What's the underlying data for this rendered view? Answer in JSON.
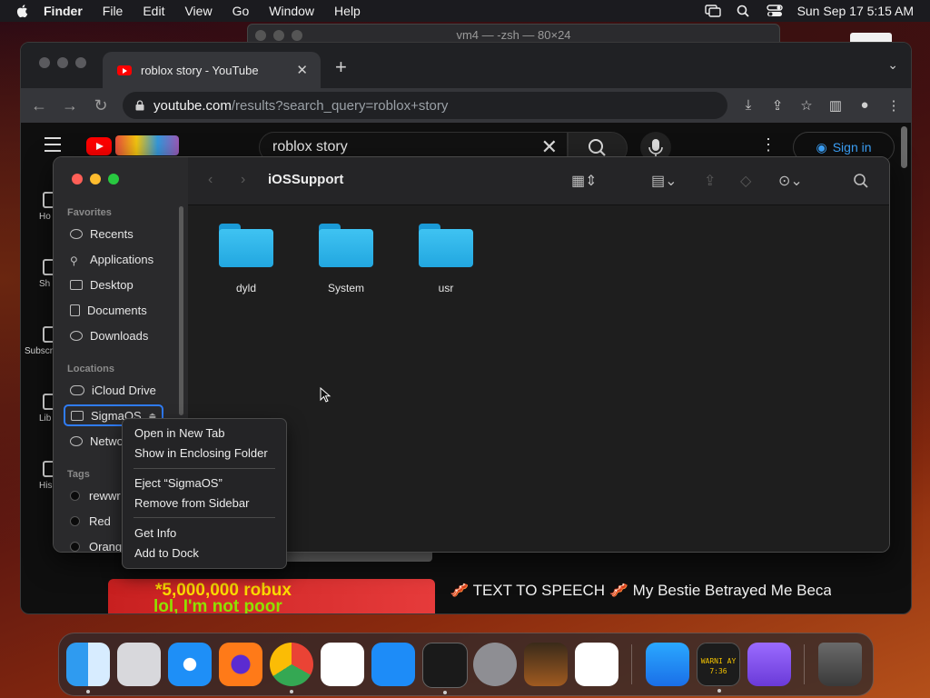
{
  "menubar": {
    "app": "Finder",
    "items": [
      "File",
      "Edit",
      "View",
      "Go",
      "Window",
      "Help"
    ],
    "datetime": "Sun Sep 17  5:15 AM"
  },
  "terminal": {
    "title": "vm4 — -zsh — 80×24"
  },
  "browser": {
    "tab_title": "roblox story - YouTube",
    "url_domain": "youtube.com",
    "url_path": "/results?search_query=roblox+story",
    "search_value": "roblox story",
    "signin_label": "Sign in",
    "sidebar": [
      {
        "label": "Ho"
      },
      {
        "label": "Sh"
      },
      {
        "label": "Subscri"
      },
      {
        "label": "Lib"
      },
      {
        "label": "His"
      }
    ],
    "video": {
      "thumb_text": "*5,000,000 robux",
      "thumb_text2": "lol, I'm not poor",
      "title": "🥓 TEXT TO SPEECH 🥓 My Bestie Betrayed Me Because She Thought I Was A Poor Bacon 🥓"
    }
  },
  "finder": {
    "title": "iOSSupport",
    "favorites_header": "Favorites",
    "favorites": [
      "Recents",
      "Applications",
      "Desktop",
      "Documents",
      "Downloads"
    ],
    "locations_header": "Locations",
    "locations": [
      "iCloud Drive",
      "SigmaOS",
      "Netwo"
    ],
    "tags_header": "Tags",
    "tags": [
      "rewwr",
      "Red",
      "Orang"
    ],
    "folders": [
      "dyld",
      "System",
      "usr"
    ]
  },
  "context_menu": {
    "items": [
      "Open in New Tab",
      "Show in Enclosing Folder",
      "Eject “SigmaOS”",
      "Remove from Sidebar",
      "Get Info",
      "Add to Dock"
    ]
  },
  "dock": {
    "warning_text": "WARNI AY 7:36"
  },
  "colors": {
    "selection": "#2f7cf6",
    "folder": "#3fc3f2",
    "youtube_red": "#ff0000",
    "link_blue": "#3ea6ff"
  }
}
